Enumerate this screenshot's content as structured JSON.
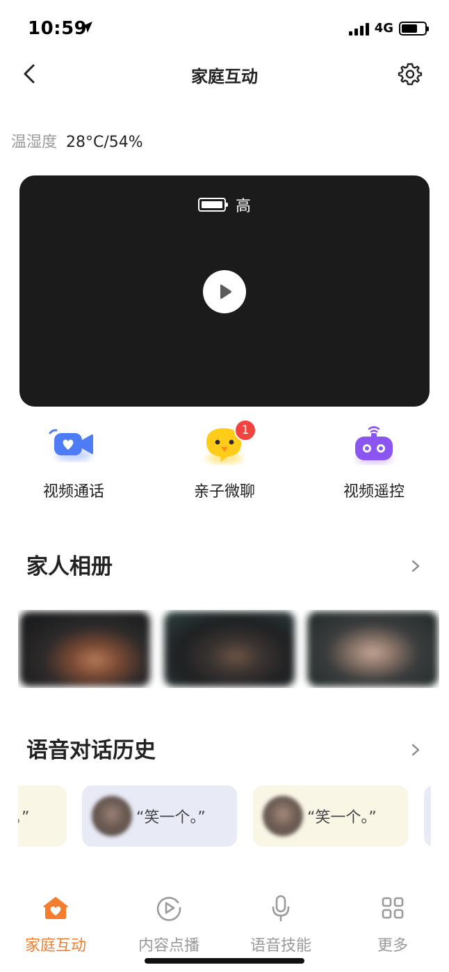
{
  "status_bar": {
    "time": "10:59",
    "network": "4G"
  },
  "nav": {
    "title": "家庭互动"
  },
  "temperature": {
    "label": "温湿度",
    "value": "28°C/54%"
  },
  "video": {
    "battery_level_label": "高"
  },
  "actions": [
    {
      "label": "视频通话",
      "icon": "video-call-icon",
      "color": "#4d7cf5"
    },
    {
      "label": "亲子微聊",
      "icon": "chick-chat-icon",
      "color": "#ffc800",
      "badge": "1"
    },
    {
      "label": "视频遥控",
      "icon": "robot-remote-icon",
      "color": "#8a55f0"
    }
  ],
  "album": {
    "title": "家人相册"
  },
  "voice_history": {
    "title": "语音对话历史",
    "items": [
      {
        "text": "。”"
      },
      {
        "text": "“笑一个。”"
      },
      {
        "text": "“笑一个。”"
      }
    ]
  },
  "tabs": [
    {
      "label": "家庭互动",
      "icon": "home-heart-icon",
      "active": true
    },
    {
      "label": "内容点播",
      "icon": "play-circle-icon",
      "active": false
    },
    {
      "label": "语音技能",
      "icon": "microphone-icon",
      "active": false
    },
    {
      "label": "更多",
      "icon": "grid-icon",
      "active": false
    }
  ],
  "colors": {
    "accent": "#f47d2e",
    "badge": "#f2433f",
    "inactive": "#9a9a9a"
  }
}
